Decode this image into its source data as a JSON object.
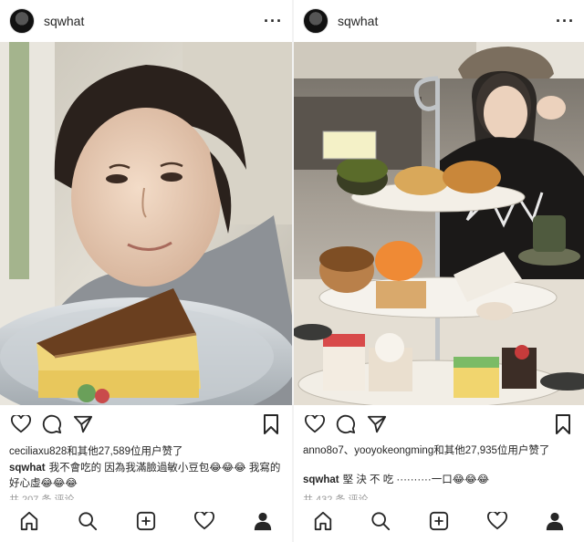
{
  "left_post": {
    "username": "sqwhat",
    "more_icon": "ellipsis-icon",
    "likes_text": "ceciliaxu828和其他27,589位用户赞了",
    "caption_user": "sqwhat",
    "caption_text": "我不會吃的 因為我滿臉過敏小豆包😂😂😂 我寫的好心虛😂😂😂",
    "comments_text": "共 207 条 评论"
  },
  "right_post": {
    "username": "sqwhat",
    "more_icon": "ellipsis-icon",
    "likes_text": "anno8o7、yooyokeongming和其他27,935位用户赞了",
    "caption_user": "sqwhat",
    "caption_text": "堅 決 不 吃 ··········一口😂😂😂",
    "comments_text": "共 432 条 评论"
  },
  "action_icons": [
    "heart-icon",
    "comment-icon",
    "send-icon",
    "bookmark-icon"
  ],
  "nav_icons": [
    "home-icon",
    "search-icon",
    "add-post-icon",
    "activity-heart-icon",
    "profile-icon"
  ]
}
